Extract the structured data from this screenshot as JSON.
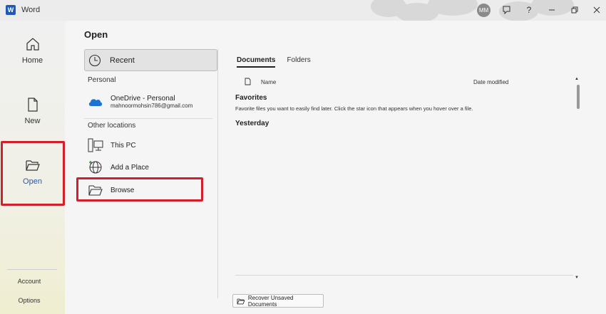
{
  "app": {
    "logo_letter": "W",
    "title": "Word",
    "user_initials": "MM"
  },
  "nav": {
    "home": "Home",
    "new": "New",
    "open": "Open",
    "account": "Account",
    "options": "Options"
  },
  "page": {
    "title": "Open"
  },
  "locations": {
    "recent": "Recent",
    "personal_label": "Personal",
    "onedrive_name": "OneDrive - Personal",
    "onedrive_email": "mahnoormohsin786@gmail.com",
    "other_label": "Other locations",
    "this_pc": "This PC",
    "add_place": "Add a Place",
    "browse": "Browse"
  },
  "files": {
    "tabs": [
      "Documents",
      "Folders"
    ],
    "col_name": "Name",
    "col_date": "Date modified",
    "favorites_title": "Favorites",
    "favorites_desc": "Favorite files you want to easily find later. Click the star icon that appears when you hover over a file.",
    "yesterday_title": "Yesterday"
  },
  "recover_button": "Recover Unsaved Documents",
  "colors": {
    "accent": "#1e5bb8",
    "highlight": "#d21f2b",
    "onedrive": "#1b74d1"
  }
}
